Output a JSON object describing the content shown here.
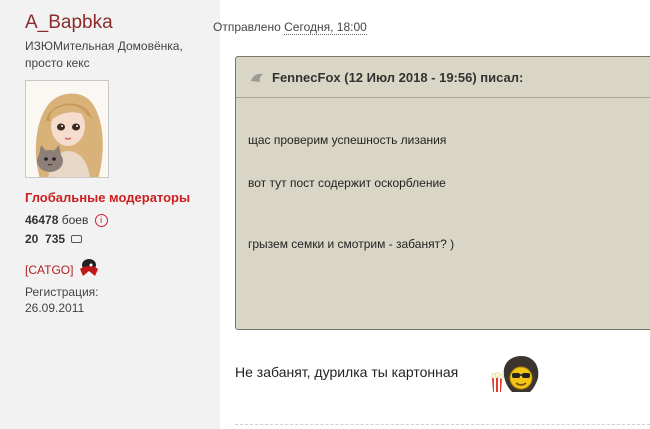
{
  "user": {
    "name": "A_Bapbka",
    "title": "ИЗЮМительная Домовёнка, просто кекс",
    "group": "Глобальные модераторы",
    "battles_count": "46478",
    "battles_label": "боев",
    "messages_count": "20  735",
    "clan": "[CATGO]",
    "registration_label": "Регистрация:",
    "registration_date": "26.09.2011"
  },
  "post": {
    "sent_label": "Отправлено",
    "sent_date": "Сегодня, 18:00",
    "quote": {
      "header": "FennecFox (12 Июл 2018 - 19:56) писал:",
      "lines": [
        "щас проверим успешность лизания",
        "вот тут пост содержит оскорбление",
        "грызем семки и смотрим - забанят? )"
      ]
    },
    "reply": "Не забанят, дурилка ты картонная"
  },
  "colors": {
    "username": "#8b2b2b",
    "group": "#cc1f1f",
    "quote_bg": "#d9d6c6",
    "quote_border": "#77756c",
    "sidebar_bg": "#f2f2f2"
  },
  "icons": [
    "info-icon",
    "message-icon",
    "clan-badge-icon",
    "quote-icon",
    "popcorn-smiley-icon"
  ]
}
